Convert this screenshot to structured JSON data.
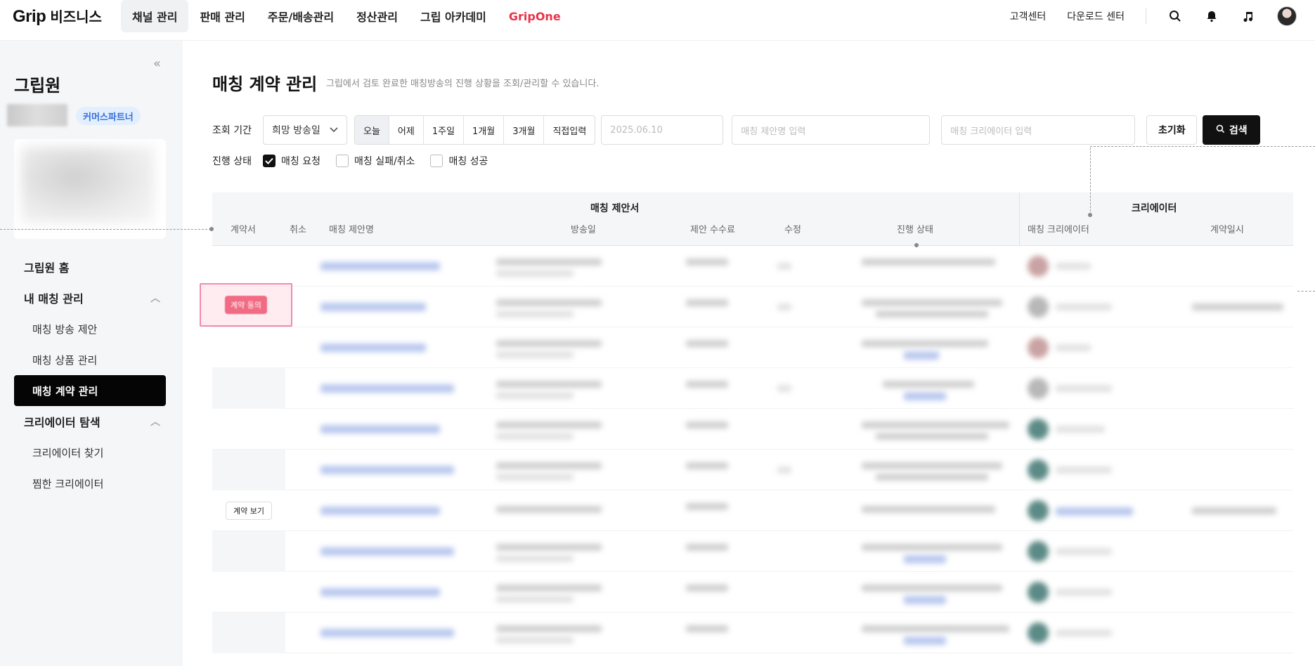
{
  "header": {
    "brand": "Grip",
    "brand_sub": "비즈니스",
    "nav": [
      {
        "label": "채널 관리",
        "active": true
      },
      {
        "label": "판매 관리"
      },
      {
        "label": "주문/배송관리"
      },
      {
        "label": "정산관리"
      },
      {
        "label": "그립 아카데미"
      },
      {
        "label": "GripOne",
        "accent": "#e8334a"
      }
    ],
    "right_links": [
      "고객센터",
      "다운로드 센터"
    ]
  },
  "sidebar": {
    "org_name": "그립원",
    "badge": "커머스파트너",
    "menu": [
      {
        "label": "그립원 홈",
        "type": "group"
      },
      {
        "label": "내 매칭 관리",
        "type": "group",
        "expanded": true
      },
      {
        "label": "매칭 방송 제안",
        "type": "sub"
      },
      {
        "label": "매칭 상품 관리",
        "type": "sub"
      },
      {
        "label": "매칭 계약 관리",
        "type": "sub",
        "selected": true
      },
      {
        "label": "크리에이터 탐색",
        "type": "group",
        "expanded": true
      },
      {
        "label": "크리에이터 찾기",
        "type": "sub"
      },
      {
        "label": "찜한 크리에이터",
        "type": "sub"
      }
    ]
  },
  "main": {
    "title": "매칭 계약 관리",
    "description": "그립에서 검토 완료한 매칭방송의 진행 상황을 조회/관리할 수 있습니다.",
    "filters": {
      "period_label": "조회 기간",
      "period_select": "희망 방송일",
      "period_buttons": [
        "오늘",
        "어제",
        "1주일",
        "1개월",
        "3개월",
        "직접입력"
      ],
      "active_period": "오늘",
      "date_value": "2025.06.10",
      "proposal_placeholder": "매칭 제안명 입력",
      "creator_placeholder": "매칭 크리에이터 입력",
      "reset_label": "초기화",
      "search_label": "검색",
      "status_label": "진행 상태",
      "statuses": [
        {
          "label": "매칭 요청",
          "checked": true
        },
        {
          "label": "매칭 실패/취소",
          "checked": false
        },
        {
          "label": "매칭 성공",
          "checked": false
        }
      ]
    },
    "table": {
      "group_proposal": "매칭 제안서",
      "group_creator": "크리에이터",
      "columns": [
        "계약서",
        "취소",
        "매칭 제안명",
        "방송일",
        "제안 수수료",
        "수정",
        "진행 상태",
        "매칭 크리에이터",
        "계약일시"
      ],
      "agree_button": "계약 동의",
      "view_button": "계약 보기"
    }
  }
}
